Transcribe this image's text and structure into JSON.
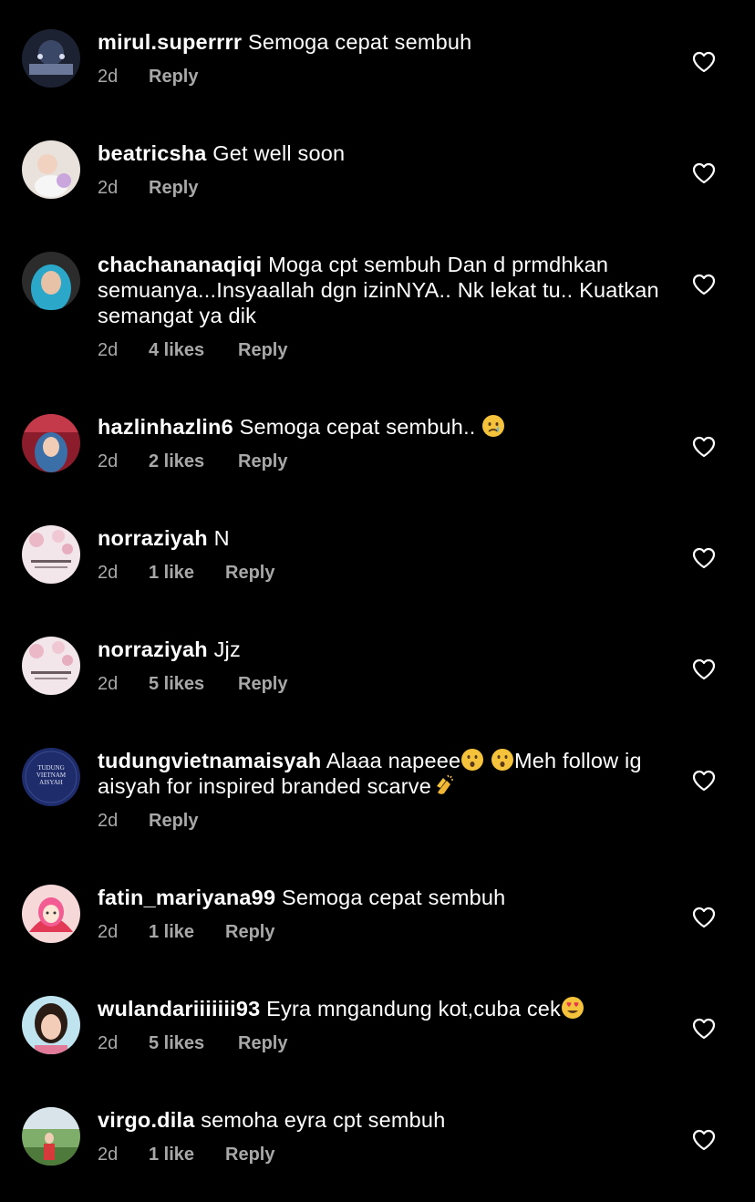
{
  "comments": [
    {
      "username": "mirul.superrrr",
      "text": "Semoga cepat sembuh",
      "time": "2d",
      "likes": "",
      "reply": "Reply",
      "avatar": "night-icon"
    },
    {
      "username": "beatricsha",
      "text": "Get well soon",
      "time": "2d",
      "likes": "",
      "reply": "Reply",
      "avatar": "baby-icon"
    },
    {
      "username": "chachananaqiqi",
      "text": "Moga cpt sembuh Dan d prmdhkan semuanya...Insyaallah dgn izinNYA.. Nk lekat tu.. Kuatkan semangat ya dik",
      "time": "2d",
      "likes": "4 likes",
      "reply": "Reply",
      "avatar": "hijab-person-icon"
    },
    {
      "username": "hazlinhazlin6",
      "text": "Semoga cepat sembuh..",
      "emoji_after": "crying-face-emoji",
      "time": "2d",
      "likes": "2 likes",
      "reply": "Reply",
      "avatar": "person-icon"
    },
    {
      "username": "norraziyah",
      "text": "N",
      "time": "2d",
      "likes": "1 like",
      "reply": "Reply",
      "avatar": "blossom-icon"
    },
    {
      "username": "norraziyah",
      "text": "Jjz",
      "time": "2d",
      "likes": "5 likes",
      "reply": "Reply",
      "avatar": "blossom-icon"
    },
    {
      "username": "tudungvietnamaisyah",
      "text_part1": "Alaaa napeee",
      "text_part2": "Meh follow ig aisyah for inspired branded scarve",
      "time": "2d",
      "likes": "",
      "reply": "Reply",
      "avatar": "brand-logo-icon",
      "logo_text": "TUDUNG VIETNAM AISYAH"
    },
    {
      "username": "fatin_mariyana99",
      "text": "Semoga cepat sembuh",
      "time": "2d",
      "likes": "1 like",
      "reply": "Reply",
      "avatar": "hijab-cartoon-icon"
    },
    {
      "username": "wulandariiiiiii93",
      "text": "Eyra mngandung kot,cuba cek",
      "emoji_after": "heart-eyes-emoji",
      "time": "2d",
      "likes": "5 likes",
      "reply": "Reply",
      "avatar": "person-icon"
    },
    {
      "username": "virgo.dila",
      "text": "semoha eyra cpt sembuh",
      "time": "2d",
      "likes": "1 like",
      "reply": "Reply",
      "avatar": "landscape-person-icon"
    }
  ],
  "colors": {
    "background": "#000000",
    "text": "#ffffff",
    "meta": "#a8a8a8"
  },
  "icons": {
    "like": "heart-outline-icon"
  }
}
